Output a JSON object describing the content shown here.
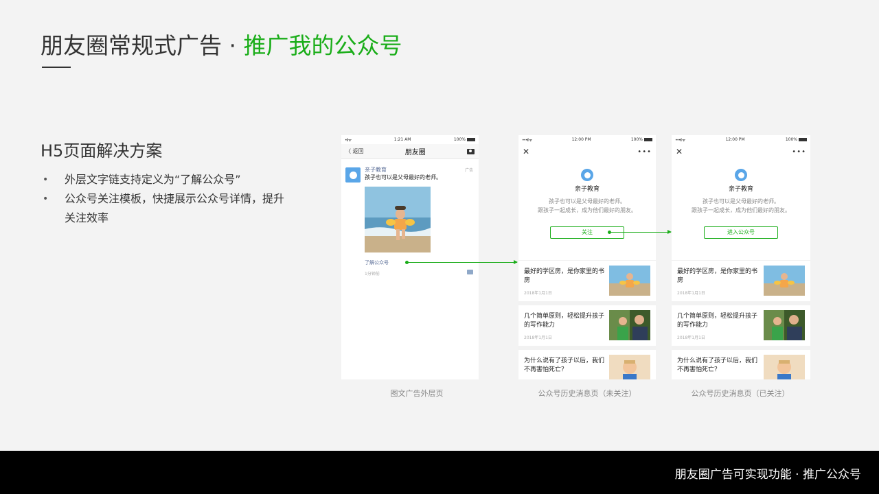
{
  "header": {
    "title_main": "朋友圈常规式广告 · ",
    "title_highlight": "推广我的公众号"
  },
  "section": {
    "title": "H5页面解决方案",
    "bullets": [
      "外层文字链支持定义为“了解公众号”",
      "公众号关注模板，快捷展示公众号详情，提升关注效率"
    ],
    "bullet_marker": "•"
  },
  "phone_feed": {
    "status": {
      "signal": "•ıl ᯤ",
      "time": "1:21 AM",
      "battery": "100%"
    },
    "nav": {
      "back": "〈 返回",
      "title": "朋友圈"
    },
    "post": {
      "account": "亲子教育",
      "tag": "广告",
      "text": "孩子也可以是父母最好的老师。",
      "link": "了解公众号",
      "time": "1分钟前"
    },
    "caption": "图文广告外层页"
  },
  "phone_unfollowed": {
    "status": {
      "signal": "•••ıl ᯤ",
      "time": "12:00 PM",
      "battery": "100%"
    },
    "nav": {
      "close": "✕",
      "more": "•••"
    },
    "profile": {
      "name": "亲子教育",
      "desc_1": "孩子也可以是父母最好的老师。",
      "desc_2": "跟孩子一起成长，成为他们最好的朋友。",
      "button": "关注"
    },
    "articles": [
      {
        "title": "最好的学区房，是你家里的书房",
        "date": "2018年1月1日"
      },
      {
        "title": "几个简单原则，轻松提升孩子的写作能力",
        "date": "2018年1月1日"
      },
      {
        "title": "为什么说有了孩子以后，我们不再害怕死亡？",
        "date": ""
      }
    ],
    "caption": "公众号历史消息页（未关注）"
  },
  "phone_followed": {
    "status": {
      "signal": "•••ıl ᯤ",
      "time": "12:00 PM",
      "battery": "100%"
    },
    "nav": {
      "close": "✕",
      "more": "•••"
    },
    "profile": {
      "name": "亲子教育",
      "desc_1": "孩子也可以是父母最好的老师。",
      "desc_2": "跟孩子一起成长，成为他们最好的朋友。",
      "button": "进入公众号"
    },
    "articles": [
      {
        "title": "最好的学区房，是你家里的书房",
        "date": "2018年1月1日"
      },
      {
        "title": "几个简单原则，轻松提升孩子的写作能力",
        "date": "2018年1月1日"
      },
      {
        "title": "为什么说有了孩子以后，我们不再害怕死亡？",
        "date": ""
      }
    ],
    "caption": "公众号历史消息页（已关注）"
  },
  "footer": {
    "text": "朋友圈广告可实现功能 · 推广公众号"
  },
  "colors": {
    "accent": "#1aad19",
    "link": "#576b95",
    "footer_bg": "#000000"
  },
  "icons": [
    "chevron-left-icon",
    "camera-icon",
    "close-icon",
    "more-icon",
    "comment-icon",
    "account-logo-icon"
  ]
}
